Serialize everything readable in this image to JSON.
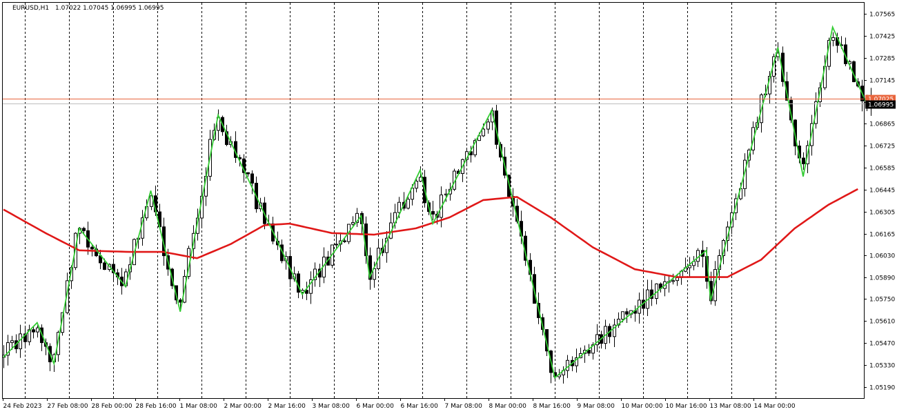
{
  "header": {
    "symbol": "EURUSD,H1",
    "ohlc": "1.07022 1.07045 1.06995 1.06995"
  },
  "colors": {
    "background": "#ffffff",
    "axis": "#000000",
    "grid": "#000000",
    "candle": "#000000",
    "zigzag": "#33cc33",
    "ma": "#e01818",
    "ask_line": "#e8643c",
    "bid_line": "#bdbdbd",
    "ask_label_bg": "#e8643c",
    "bid_label_bg": "#000000"
  },
  "chart_data": {
    "type": "candlestick",
    "symbol": "EURUSD",
    "timeframe": "H1",
    "ylim": [
      1.0512,
      1.07635
    ],
    "grid": "vertical-dashed",
    "y_ticks": [
      "1.07565",
      "1.07425",
      "1.07285",
      "1.07145",
      "1.07005",
      "1.06865",
      "1.06725",
      "1.06585",
      "1.06445",
      "1.06305",
      "1.06165",
      "1.06030",
      "1.05890",
      "1.05750",
      "1.05610",
      "1.05470",
      "1.05330",
      "1.05190"
    ],
    "x_tick_labels": [
      "24 Feb 2023",
      "27 Feb 08:00",
      "28 Feb 00:00",
      "28 Feb 16:00",
      "1 Mar 08:00",
      "2 Mar 00:00",
      "2 Mar 16:00",
      "3 Mar 08:00",
      "6 Mar 00:00",
      "6 Mar 16:00",
      "7 Mar 08:00",
      "8 Mar 00:00",
      "8 Mar 16:00",
      "9 Mar 08:00",
      "10 Mar 00:00",
      "10 Mar 16:00",
      "13 Mar 08:00",
      "14 Mar 00:00"
    ],
    "x_tick_count": 18,
    "bar_count": 207,
    "price_levels": {
      "ask": {
        "label": "1.07025",
        "value": 1.07025
      },
      "bid": {
        "label": "1.06995",
        "value": 1.06995
      }
    },
    "zigzag": [
      {
        "bar": 0,
        "price": 1.0538
      },
      {
        "bar": 8,
        "price": 1.056
      },
      {
        "bar": 12,
        "price": 1.0534
      },
      {
        "bar": 18,
        "price": 1.062
      },
      {
        "bar": 29,
        "price": 1.0583
      },
      {
        "bar": 35,
        "price": 1.0644
      },
      {
        "bar": 42,
        "price": 1.0567
      },
      {
        "bar": 51,
        "price": 1.0692
      },
      {
        "bar": 71,
        "price": 1.0578
      },
      {
        "bar": 85,
        "price": 1.0628
      },
      {
        "bar": 87,
        "price": 1.0589
      },
      {
        "bar": 99,
        "price": 1.0657
      },
      {
        "bar": 102,
        "price": 1.0623
      },
      {
        "bar": 116,
        "price": 1.0695
      },
      {
        "bar": 131,
        "price": 1.0525
      },
      {
        "bar": 167,
        "price": 1.0606
      },
      {
        "bar": 168,
        "price": 1.0574
      },
      {
        "bar": 184,
        "price": 1.0735
      },
      {
        "bar": 190,
        "price": 1.0653
      },
      {
        "bar": 197,
        "price": 1.0748
      },
      {
        "bar": 205,
        "price": 1.07
      }
    ],
    "ma": [
      {
        "bar": 0,
        "price": 1.0632
      },
      {
        "bar": 10,
        "price": 1.0617
      },
      {
        "bar": 18,
        "price": 1.0606
      },
      {
        "bar": 30,
        "price": 1.0605
      },
      {
        "bar": 38,
        "price": 1.0605
      },
      {
        "bar": 46,
        "price": 1.0601
      },
      {
        "bar": 54,
        "price": 1.061
      },
      {
        "bar": 62,
        "price": 1.0622
      },
      {
        "bar": 68,
        "price": 1.0623
      },
      {
        "bar": 78,
        "price": 1.0617
      },
      {
        "bar": 88,
        "price": 1.0616
      },
      {
        "bar": 98,
        "price": 1.062
      },
      {
        "bar": 106,
        "price": 1.0627
      },
      {
        "bar": 114,
        "price": 1.0638
      },
      {
        "bar": 122,
        "price": 1.064
      },
      {
        "bar": 130,
        "price": 1.0627
      },
      {
        "bar": 140,
        "price": 1.0608
      },
      {
        "bar": 150,
        "price": 1.0594
      },
      {
        "bar": 160,
        "price": 1.0589
      },
      {
        "bar": 172,
        "price": 1.0589
      },
      {
        "bar": 180,
        "price": 1.06
      },
      {
        "bar": 188,
        "price": 1.062
      },
      {
        "bar": 196,
        "price": 1.0635
      },
      {
        "bar": 203,
        "price": 1.0645
      }
    ]
  }
}
